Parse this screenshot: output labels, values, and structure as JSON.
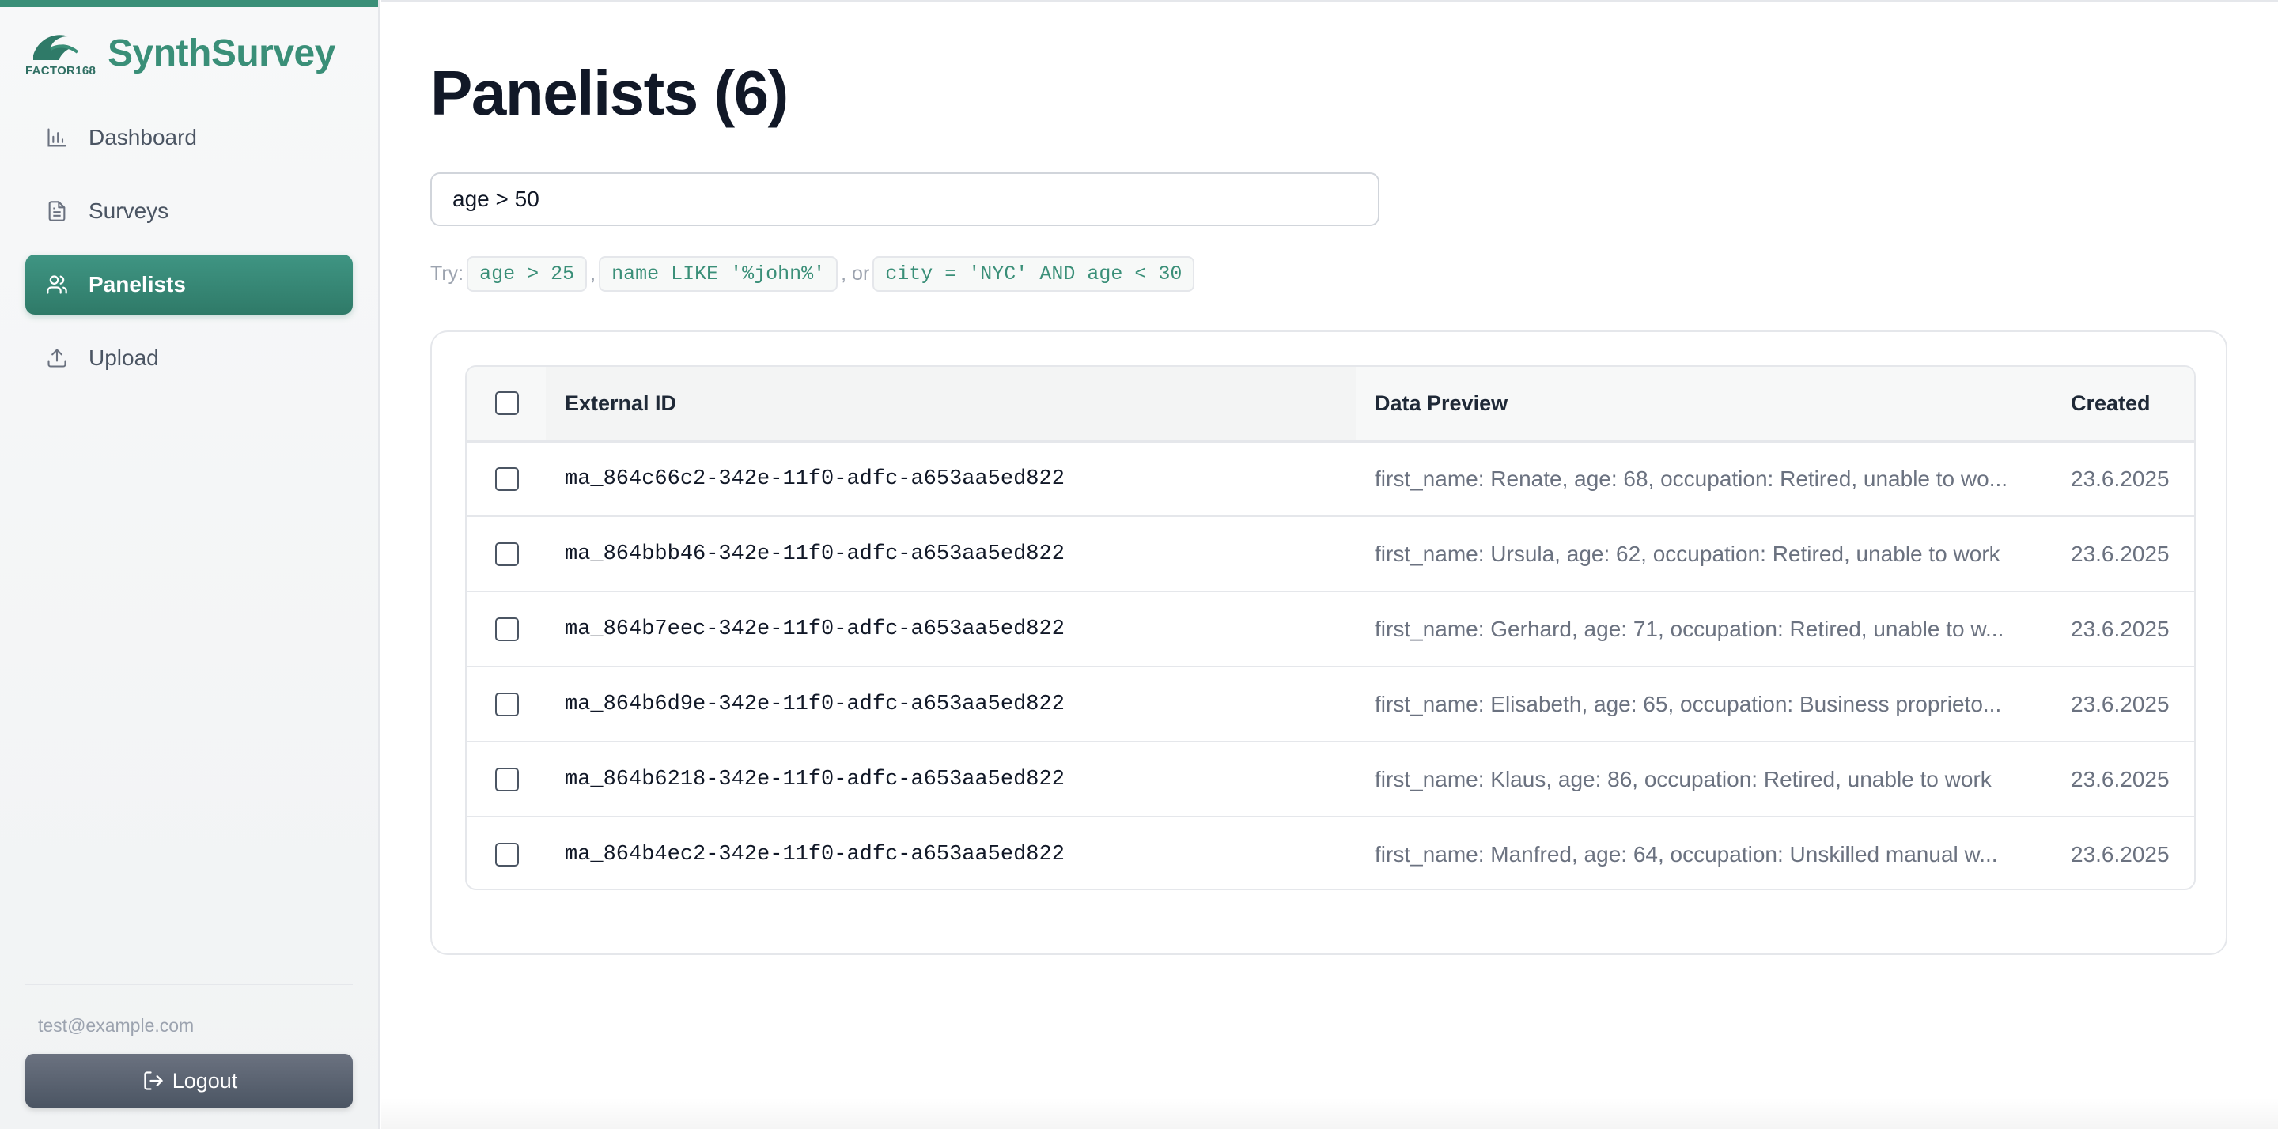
{
  "brand": {
    "name": "SynthSurvey",
    "logo_text": "FACTOR168",
    "accent_color": "#3a8f78"
  },
  "sidebar": {
    "items": [
      {
        "label": "Dashboard",
        "icon": "bar-chart-icon",
        "active": false
      },
      {
        "label": "Surveys",
        "icon": "document-icon",
        "active": false
      },
      {
        "label": "Panelists",
        "icon": "users-icon",
        "active": true
      },
      {
        "label": "Upload",
        "icon": "upload-icon",
        "active": false
      }
    ],
    "user_email": "test@example.com",
    "logout_label": "Logout"
  },
  "main": {
    "title": "Panelists (6)",
    "search": {
      "value": "age > 50",
      "placeholder": ""
    },
    "hints": {
      "prefix": "Try:",
      "examples": [
        "age > 25",
        "name LIKE '%john%'",
        "city = 'NYC' AND age < 30"
      ],
      "sep1": ",",
      "sep2": ", or"
    },
    "table": {
      "columns": [
        "External ID",
        "Data Preview",
        "Created"
      ],
      "rows": [
        {
          "id": "ma_864c66c2-342e-11f0-adfc-a653aa5ed822",
          "preview": "first_name: Renate, age: 68, occupation: Retired, unable to wo...",
          "created": "23.6.2025"
        },
        {
          "id": "ma_864bbb46-342e-11f0-adfc-a653aa5ed822",
          "preview": "first_name: Ursula, age: 62, occupation: Retired, unable to work",
          "created": "23.6.2025"
        },
        {
          "id": "ma_864b7eec-342e-11f0-adfc-a653aa5ed822",
          "preview": "first_name: Gerhard, age: 71, occupation: Retired, unable to w...",
          "created": "23.6.2025"
        },
        {
          "id": "ma_864b6d9e-342e-11f0-adfc-a653aa5ed822",
          "preview": "first_name: Elisabeth, age: 65, occupation: Business proprieto...",
          "created": "23.6.2025"
        },
        {
          "id": "ma_864b6218-342e-11f0-adfc-a653aa5ed822",
          "preview": "first_name: Klaus, age: 86, occupation: Retired, unable to work",
          "created": "23.6.2025"
        },
        {
          "id": "ma_864b4ec2-342e-11f0-adfc-a653aa5ed822",
          "preview": "first_name: Manfred, age: 64, occupation: Unskilled manual w...",
          "created": "23.6.2025"
        }
      ]
    }
  }
}
